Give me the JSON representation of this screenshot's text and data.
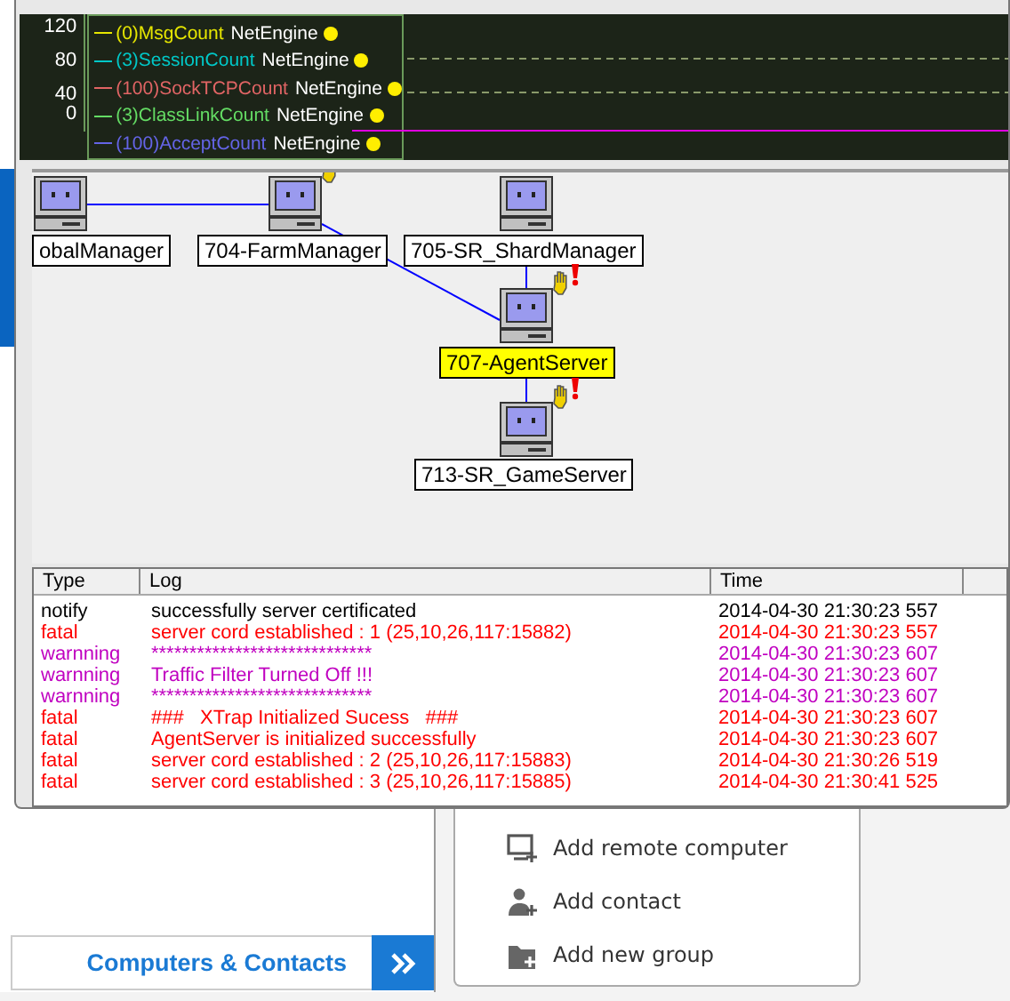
{
  "chart": {
    "yticks": [
      "120",
      "80",
      "40",
      "0"
    ],
    "legend": [
      {
        "label": "(0)MsgCount",
        "source": "NetEngine",
        "color": "#e6e600"
      },
      {
        "label": "(3)SessionCount",
        "source": "NetEngine",
        "color": "#00c8c8"
      },
      {
        "label": "(100)SockTCPCount",
        "source": "NetEngine",
        "color": "#e06464"
      },
      {
        "label": "(3)ClassLinkCount",
        "source": "NetEngine",
        "color": "#64dc64"
      },
      {
        "label": "(100)AcceptCount",
        "source": "NetEngine",
        "color": "#6464e6"
      }
    ]
  },
  "nodes": [
    {
      "label": "obalManager",
      "highlighted": false,
      "waving": false,
      "alert": false
    },
    {
      "label": "704-FarmManager",
      "highlighted": false,
      "waving": true,
      "alert": false
    },
    {
      "label": "705-SR_ShardManager",
      "highlighted": false,
      "waving": false,
      "alert": false
    },
    {
      "label": "707-AgentServer",
      "highlighted": true,
      "waving": true,
      "alert": true
    },
    {
      "label": "713-SR_GameServer",
      "highlighted": false,
      "waving": true,
      "alert": true
    }
  ],
  "log": {
    "columns": [
      "Type",
      "Log",
      "Time"
    ],
    "rows": [
      {
        "kind": "notify",
        "type": "notify",
        "log": "successfully server certificated",
        "time": "2014-04-30 21:30:23 557"
      },
      {
        "kind": "fatal",
        "type": "fatal",
        "log": "server cord established : 1 (25,10,26,117:15882)",
        "time": "2014-04-30 21:30:23 557"
      },
      {
        "kind": "warning",
        "type": "warnning",
        "log": "*****************************",
        "time": "2014-04-30 21:30:23 607"
      },
      {
        "kind": "warning",
        "type": "warnning",
        "log": "Traffic Filter Turned Off !!!",
        "time": "2014-04-30 21:30:23 607"
      },
      {
        "kind": "warning",
        "type": "warnning",
        "log": "*****************************",
        "time": "2014-04-30 21:30:23 607"
      },
      {
        "kind": "fatal",
        "type": "fatal",
        "log": "###   XTrap Initialized Sucess   ###",
        "time": "2014-04-30 21:30:23 607"
      },
      {
        "kind": "fatal",
        "type": "fatal",
        "log": "AgentServer is initialized successfully",
        "time": "2014-04-30 21:30:23 607"
      },
      {
        "kind": "fatal",
        "type": "fatal",
        "log": "server cord established : 2 (25,10,26,117:15883)",
        "time": "2014-04-30 21:30:26 519"
      },
      {
        "kind": "fatal",
        "type": "fatal",
        "log": "server cord established : 3 (25,10,26,117:15885)",
        "time": "2014-04-30 21:30:41 525"
      }
    ]
  },
  "background": {
    "tab": "Computers & Contacts",
    "actions": [
      {
        "kind": "computer",
        "label": "Add remote computer"
      },
      {
        "kind": "contact",
        "label": "Add contact"
      },
      {
        "kind": "group",
        "label": "Add new group"
      }
    ]
  }
}
